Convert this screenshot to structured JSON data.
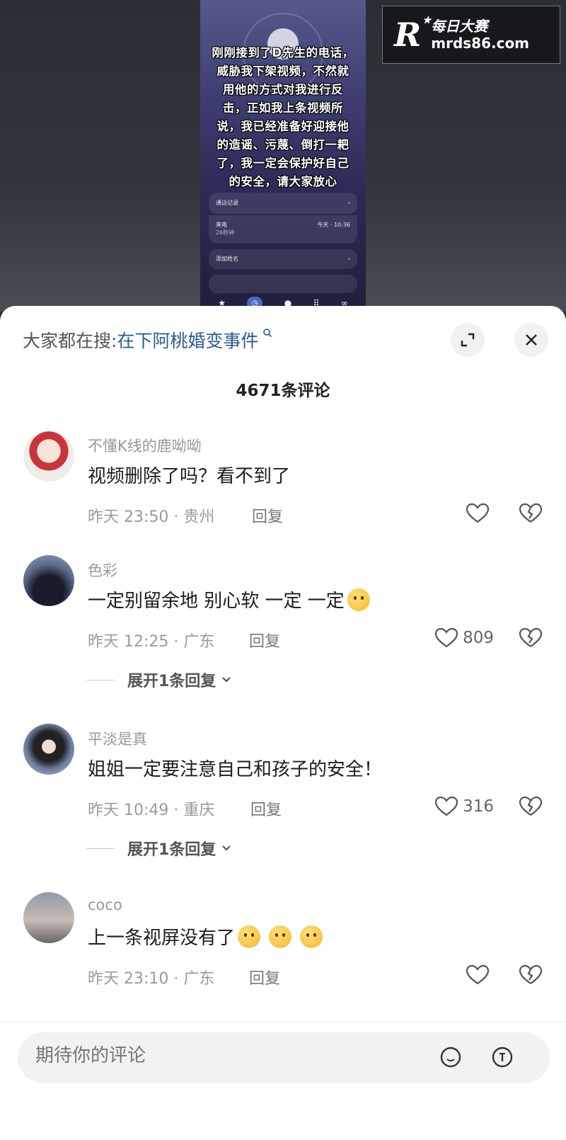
{
  "video": {
    "overlay_text": "刚刚接到了D先生的电话，威胁我下架视频，不然就用他的方式对我进行反击，正如我上条视频所说，我已经准备好迎接他的造谣、污蔑、倒打一耙了，我一定会保护好自己的安全，请大家放心",
    "call_records_label": "通话记录",
    "incoming_label": "来电",
    "incoming_duration": "26秒钟",
    "incoming_time": "今天 · 10:36",
    "add_name_label": "添加姓名"
  },
  "watermark": {
    "cn": "每日大赛",
    "url": "mrds86.com"
  },
  "search": {
    "prefix": "大家都在搜:",
    "query": "在下阿桃婚变事件"
  },
  "comment_count": "4671条评论",
  "comments": [
    {
      "user": "不懂K线的鹿呦呦",
      "text": "视频删除了吗？看不到了",
      "meta": "昨天 23:50 · 贵州",
      "reply": "回复",
      "likes": ""
    },
    {
      "user": "色彩",
      "text": "一定别留余地 别心软 一定 一定",
      "meta": "昨天 12:25 · 广东",
      "reply": "回复",
      "likes": "809",
      "expand": "展开1条回复"
    },
    {
      "user": "平淡是真",
      "text": "姐姐一定要注意自己和孩子的安全！",
      "meta": "昨天 10:49 · 重庆",
      "reply": "回复",
      "likes": "316",
      "expand": "展开1条回复"
    },
    {
      "user": "coco",
      "text": "上一条视屏没有了",
      "meta": "昨天 23:10 · 广东",
      "reply": "回复",
      "likes": ""
    }
  ],
  "input": {
    "placeholder": "期待你的评论"
  },
  "colors": {
    "accent_link": "#2b5b92",
    "sheet_bg": "#ffffff",
    "muted_text": "#999999"
  },
  "icons": {
    "expand": "expand-icon",
    "close": "close-icon",
    "like": "heart-icon",
    "dislike": "broken-heart-icon",
    "chevron": "chevron-down-icon",
    "emoji_picker": "emoji-icon",
    "at_mention": "at-icon"
  }
}
